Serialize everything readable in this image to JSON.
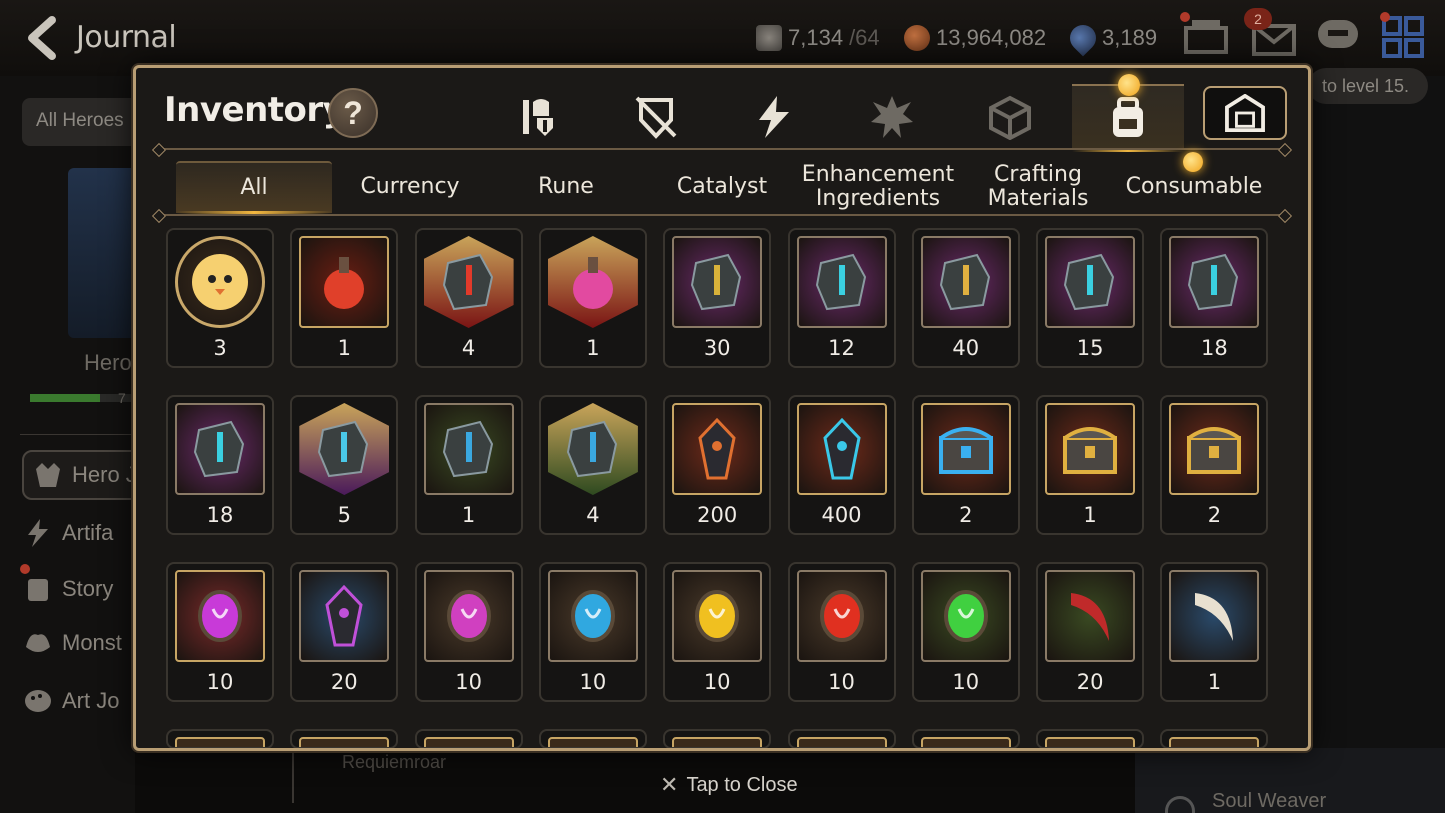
{
  "background": {
    "title": "Journal",
    "currencies": [
      {
        "icon": "stamina-icon",
        "value": "7,134",
        "max": "/64"
      },
      {
        "icon": "gold-coin-icon",
        "value": "13,964,082"
      },
      {
        "icon": "skystone-icon",
        "value": "3,189"
      }
    ],
    "all_heroes_label": "All Heroes",
    "hero_label": "Hero",
    "hero_bar_num": "7",
    "level_tip": "to level 15.",
    "side_nav": [
      {
        "label": "Hero J",
        "icon": "hero-icon"
      },
      {
        "label": "Artifa",
        "icon": "lightning-icon"
      },
      {
        "label": "Story",
        "icon": "scroll-icon"
      },
      {
        "label": "Monst",
        "icon": "monster-icon"
      },
      {
        "label": "Art Jo",
        "icon": "palette-icon"
      }
    ],
    "requiemroar": "Requiemroar",
    "soul_weaver": "Soul Weaver",
    "mail_badge": "2"
  },
  "modal": {
    "title": "Inventory",
    "help": "?",
    "categories": [
      {
        "name": "hero-equip-icon",
        "selected": false
      },
      {
        "name": "sword-shield-icon",
        "selected": false
      },
      {
        "name": "lightning-icon",
        "selected": false
      },
      {
        "name": "spiky-material-icon",
        "selected": false
      },
      {
        "name": "cube-icon",
        "selected": false
      },
      {
        "name": "backpack-icon",
        "selected": true
      }
    ],
    "tabs": [
      {
        "label": "All",
        "active": true
      },
      {
        "label": "Currency",
        "active": false
      },
      {
        "label": "Rune",
        "active": false
      },
      {
        "label": "Catalyst",
        "active": false
      },
      {
        "label": "Enhancement Ingredients",
        "active": false
      },
      {
        "label": "Crafting Materials",
        "active": false
      },
      {
        "label": "Consumable",
        "active": false
      }
    ],
    "rows": [
      [
        {
          "count": "3",
          "icon": "chick-token-icon",
          "bg": "#3b2d1e",
          "shape": "circle"
        },
        {
          "count": "1",
          "icon": "red-potion-icon",
          "bg": "#6b1e12",
          "shape": "gold"
        },
        {
          "count": "4",
          "icon": "red-rune-stone-icon",
          "bg": "#7a1414",
          "shape": "hex"
        },
        {
          "count": "1",
          "icon": "pink-potion-icon",
          "bg": "#7a1414",
          "shape": "hex"
        },
        {
          "count": "30",
          "icon": "rune-exclaim-icon",
          "bg": "#6a2a6a",
          "shape": "plain"
        },
        {
          "count": "12",
          "icon": "rune-boot-icon",
          "bg": "#6a2a6a",
          "shape": "plain"
        },
        {
          "count": "40",
          "icon": "rune-hammer-icon",
          "bg": "#6a2a6a",
          "shape": "plain"
        },
        {
          "count": "15",
          "icon": "rune-swirl-icon",
          "bg": "#6a2a6a",
          "shape": "plain"
        },
        {
          "count": "18",
          "icon": "rune-sword-icon",
          "bg": "#6a2a6a",
          "shape": "plain"
        }
      ],
      [
        {
          "count": "18",
          "icon": "rune-armor-icon",
          "bg": "#6a2a6a",
          "shape": "plain"
        },
        {
          "count": "5",
          "icon": "purple-star-rune-icon",
          "bg": "#4a1a5a",
          "shape": "hex"
        },
        {
          "count": "1",
          "icon": "stone-sword-rune-icon",
          "bg": "#3a4a22",
          "shape": "plain"
        },
        {
          "count": "4",
          "icon": "stone-star-rune-icon",
          "bg": "#2e4a20",
          "shape": "hex"
        },
        {
          "count": "200",
          "icon": "dark-crystal-icon",
          "bg": "#6e2a1a",
          "shape": "gold"
        },
        {
          "count": "400",
          "icon": "blue-shard-icon",
          "bg": "#6e2a1a",
          "shape": "gold"
        },
        {
          "count": "2",
          "icon": "blue-chest-icon",
          "bg": "#6e2a1a",
          "shape": "gold"
        },
        {
          "count": "1",
          "icon": "gold-chest-icon",
          "bg": "#6e2a1a",
          "shape": "gold"
        },
        {
          "count": "2",
          "icon": "gold-chest-icon",
          "bg": "#6e2a1a",
          "shape": "gold"
        }
      ],
      [
        {
          "count": "10",
          "icon": "purple-moon-gem-icon",
          "bg": "#7a2a2a",
          "shape": "gold"
        },
        {
          "count": "20",
          "icon": "purple-moon-shard-icon",
          "bg": "#2a4a6a",
          "shape": "plain"
        },
        {
          "count": "10",
          "icon": "purple-moon-orb-icon",
          "bg": "#4a3a2a",
          "shape": "plain"
        },
        {
          "count": "10",
          "icon": "blue-snow-orb-icon",
          "bg": "#4a3a2a",
          "shape": "plain"
        },
        {
          "count": "10",
          "icon": "yellow-orb-icon",
          "bg": "#4a3a2a",
          "shape": "plain"
        },
        {
          "count": "10",
          "icon": "red-orb-icon",
          "bg": "#4a3a2a",
          "shape": "plain"
        },
        {
          "count": "10",
          "icon": "green-orb-icon",
          "bg": "#3a4a22",
          "shape": "plain"
        },
        {
          "count": "20",
          "icon": "red-claw-icon",
          "bg": "#3a4a22",
          "shape": "plain"
        },
        {
          "count": "1",
          "icon": "fang-icon",
          "bg": "#2a4a6a",
          "shape": "plain"
        }
      ]
    ],
    "partial_row": 9,
    "tap_to_close": "Tap to Close"
  },
  "colors": {
    "accent_gold": "#f4b840",
    "frame_gold": "#b99e74",
    "notif_red": "#b13a2a"
  }
}
